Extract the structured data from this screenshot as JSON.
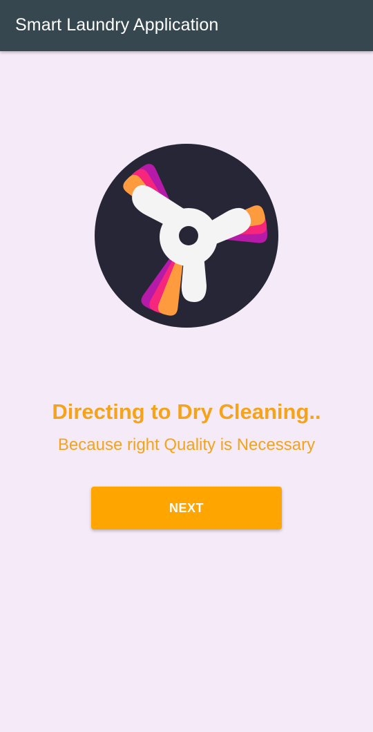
{
  "app_bar": {
    "title": "Smart Laundry Application"
  },
  "logo": {
    "icon": "laundry-spinner-logo",
    "background_color": "#262636",
    "blade_color": "#f4f4f4",
    "accent_colors": [
      "#ff9b3f",
      "#f7267d",
      "#b51ba8"
    ]
  },
  "main": {
    "headline": "Directing to Dry Cleaning..",
    "subline": "Because right Quality is Necessary",
    "next_button_label": "NEXT"
  },
  "colors": {
    "app_bar": "#37474f",
    "background": "#f5eaf7",
    "accent_text": "#f5a31a",
    "button": "#ffa500"
  }
}
